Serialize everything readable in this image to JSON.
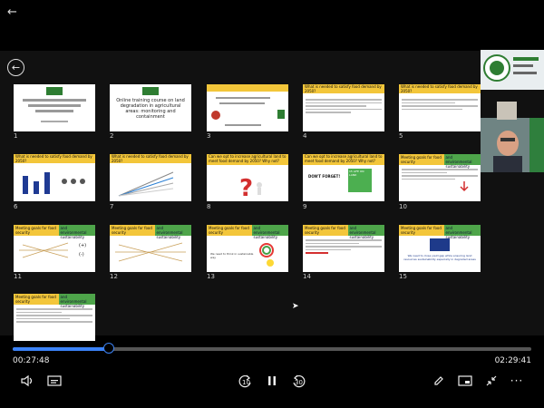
{
  "player": {
    "elapsed": "00:27:48",
    "total": "02:29:41",
    "progress_fraction": 0.186,
    "skip_back_label": "10",
    "skip_fwd_label": "30"
  },
  "slides": [
    {
      "n": "1",
      "title": "",
      "type": "title-ar"
    },
    {
      "n": "2",
      "title": "Online training course on land degradation in agricultural areas: monitoring and containment",
      "type": "title-en"
    },
    {
      "n": "3",
      "title": "",
      "type": "agenda"
    },
    {
      "n": "4",
      "title": "What is needed to satisfy food demand by 2050?",
      "type": "yellow"
    },
    {
      "n": "5",
      "title": "What is needed to satisfy food demand by 2050?",
      "type": "yellow"
    },
    {
      "n": "6",
      "title": "What is needed to satisfy food demand by 2050?",
      "type": "yellow"
    },
    {
      "n": "7",
      "title": "What is needed to satisfy food demand by 2050?",
      "type": "yellow"
    },
    {
      "n": "8",
      "title": "Can we opt to increase agricultural land to meet food demand by 2050? Why not?",
      "type": "yellow"
    },
    {
      "n": "9",
      "title": "Can we opt to increase agricultural land to meet food demand by 2050? Why not?",
      "type": "yellow"
    },
    {
      "n": "10",
      "title": "Meeting goals for food security",
      "type": "split",
      "right": "and environmental sustainability"
    },
    {
      "n": "11",
      "title": "Meeting goals for food security",
      "type": "split",
      "right": "and environmental sustainability"
    },
    {
      "n": "12",
      "title": "Meeting goals for food security",
      "type": "split",
      "right": "and environmental sustainability"
    },
    {
      "n": "13",
      "title": "Meeting goals for food security",
      "type": "split",
      "right": "and environmental sustainability"
    },
    {
      "n": "14",
      "title": "Meeting goals for food security",
      "type": "split",
      "right": "and environmental sustainability"
    },
    {
      "n": "15",
      "title": "Meeting goals for food security",
      "type": "split",
      "right": "and environmental sustainability"
    },
    {
      "n": "16",
      "title": "Meeting goals for food security",
      "type": "split",
      "right": "and environmental sustainability"
    }
  ],
  "slide_text": {
    "s9_sign": "DON'T FORGET!",
    "s9_sdg": "15 LIFE ON LAND",
    "s13_text": "We need to think in sustainable way",
    "s15_text": "We need to close yield gap while ensuring land resources sustainability especially in degraded areas",
    "s11_plus": "(+)",
    "s11_minus": "(-)"
  }
}
